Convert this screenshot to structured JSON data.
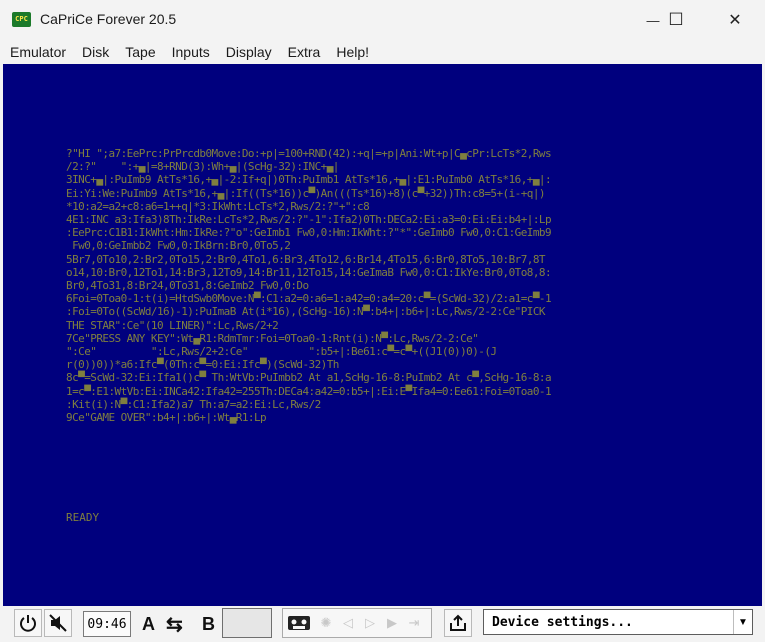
{
  "window": {
    "title": "CaPriCe Forever 20.5",
    "icon_text": "CPC",
    "minimize": "—",
    "maximize": "☐",
    "close": "✕"
  },
  "menu": [
    "Emulator",
    "Disk",
    "Tape",
    "Inputs",
    "Display",
    "Extra",
    "Help!"
  ],
  "screen": {
    "background": "#00007e",
    "text_color": "#7f7f3f",
    "basic_listing": "?\"HI \";a7:EePrc:PrPrcdb0Move:Do:+p|=100+RND(42):+q|=+p|Ani:Wt+p|C▄cPr:LcTs*2,Rws\n/2:?\"    \":+▄|=8+RND(3):Wh+▄|(ScHg-32):INC+▄|\n3INC+▄|:PuImb9 AtTs*16,+▄|-2:If+q|)0Th:PuImb1 AtTs*16,+▄|:E1:PuImb0 AtTs*16,+▄|:\nEi:Yi:We:PuImb9 AtTs*16,+▄|:If((Ts*16))c▀)An(((Ts*16)+8)(c▀+32))Th:c8=5+(i-+q|)\n*10:a2=a2+c8:a6=1++q|*3:IkWht:LcTs*2,Rws/2:?\"+\":c8\n4E1:INC a3:Ifa3)8Th:IkRe:LcTs*2,Rws/2:?\"-1\":Ifa2)0Th:DECa2:Ei:a3=0:Ei:Ei:b4+|:Lp\n:EePrc:C1B1:IkWht:Hm:IkRe:?\"o\":GeImb1 Fw0,0:Hm:IkWht:?\"*\":GeImb0 Fw0,0:C1:GeImb9\n Fw0,0:GeImbb2 Fw0,0:IkBrn:Br0,0To5,2\n5Br7,0To10,2:Br2,0To15,2:Br0,4To1,6:Br3,4To12,6:Br14,4To15,6:Br0,8To5,10:Br7,8T\no14,10:Br0,12To1,14:Br3,12To9,14:Br11,12To15,14:GeImaB Fw0,0:C1:IkYe:Br0,0To8,8:\nBr0,4To31,8:Br24,0To31,8:GeImb2 Fw0,0:Do\n6Foi=0Toa0-1:t(i)=HtdSwb0Move:N▀:C1:a2=0:a6=1:a42=0:a4=20:c▀=(ScWd-32)/2:a1=c▀-1\n:Foi=0To((ScWd/16)-1):PuImaB At(i*16),(ScHg-16):N▀:b4+|:b6+|:Lc,Rws/2-2:Ce\"PICK\nTHE STAR\":Ce\"(10 LINER)\":Lc,Rws/2+2\n7Ce\"PRESS ANY KEY\":Wt▄R1:RdmTmr:Foi=0Toa0-1:Rnt(i):N▀:Lc,Rws/2-2:Ce\"\n\":Ce\"         \":Lc,Rws/2+2:Ce\"          \":b5+|:Be61:c▀=c▀+((J1(0))0)-(J\nr(0))0))*a6:Ifc▀(0Th:c▀=0:Ei:Ifc▀)(ScWd-32)Th\n8c▀=ScWd-32:Ei:Ifa1()c▀ Th:WtVb:PuImbb2 At a1,ScHg-16-8:PuImb2 At c▀,ScHg-16-8:a\n1=c▀:E1:WtVb:Ei:INCa42:Ifa42=255Th:DECa4:a42=0:b5+|:Ei:E▀Ifa4=0:Ee61:Foi=0Toa0-1\n:Kit(i):N▀:C1:Ifa2)a7 Th:a7=a2:Ei:Lc,Rws/2\n9Ce\"GAME OVER\":b4+|:b6+|:Wt▄R1:Lp",
    "ready": "READY"
  },
  "statusbar": {
    "time": "09:46",
    "drive_a": "A",
    "drive_b": "B",
    "swap_icon": "⇆",
    "device_settings": "Device settings...",
    "dropdown_arrow": "▼"
  }
}
